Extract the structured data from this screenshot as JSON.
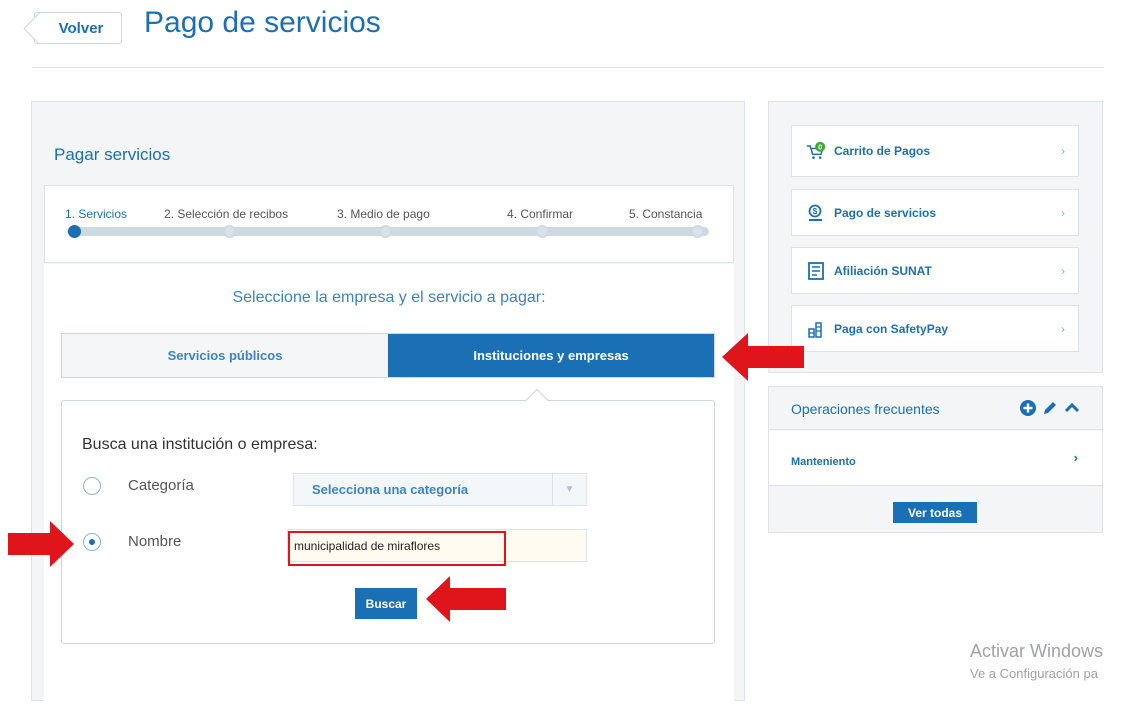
{
  "header": {
    "back_label": "Volver",
    "title": "Pago de servicios"
  },
  "main": {
    "section_title": "Pagar servicios",
    "steps": [
      {
        "label": "1. Servicios",
        "active": true
      },
      {
        "label": "2. Selección de recibos",
        "active": false
      },
      {
        "label": "3. Medio de pago",
        "active": false
      },
      {
        "label": "4. Confirmar",
        "active": false
      },
      {
        "label": "5. Constancia",
        "active": false
      }
    ],
    "prompt": "Seleccione la empresa y el servicio a pagar:",
    "tabs": [
      {
        "label": "Servicios públicos",
        "active": false
      },
      {
        "label": "Instituciones y empresas",
        "active": true
      }
    ],
    "search": {
      "heading": "Busca una institución o empresa:",
      "category_label": "Categoría",
      "category_placeholder": "Selecciona una categoría",
      "name_label": "Nombre",
      "name_value": "municipalidad de miraflores",
      "selected_option": "Nombre",
      "button_label": "Buscar"
    }
  },
  "sidebar": {
    "items": [
      {
        "label": "Carrito de Pagos",
        "icon": "cart-icon",
        "badge": "0"
      },
      {
        "label": "Pago de servicios",
        "icon": "service-payment-icon"
      },
      {
        "label": "Afiliación SUNAT",
        "icon": "document-icon"
      },
      {
        "label": "Paga con SafetyPay",
        "icon": "coins-icon"
      }
    ],
    "frequent": {
      "title": "Operaciones frecuentes",
      "rows": [
        {
          "label": "Manteniento"
        }
      ],
      "view_all_label": "Ver todas"
    }
  },
  "watermark": {
    "line1": "Activar Windows",
    "line2": "Ve a Configuración pa"
  },
  "colors": {
    "accent": "#1a6fb5",
    "annotation": "#e0141b",
    "panel_bg": "#f3f5f7"
  }
}
